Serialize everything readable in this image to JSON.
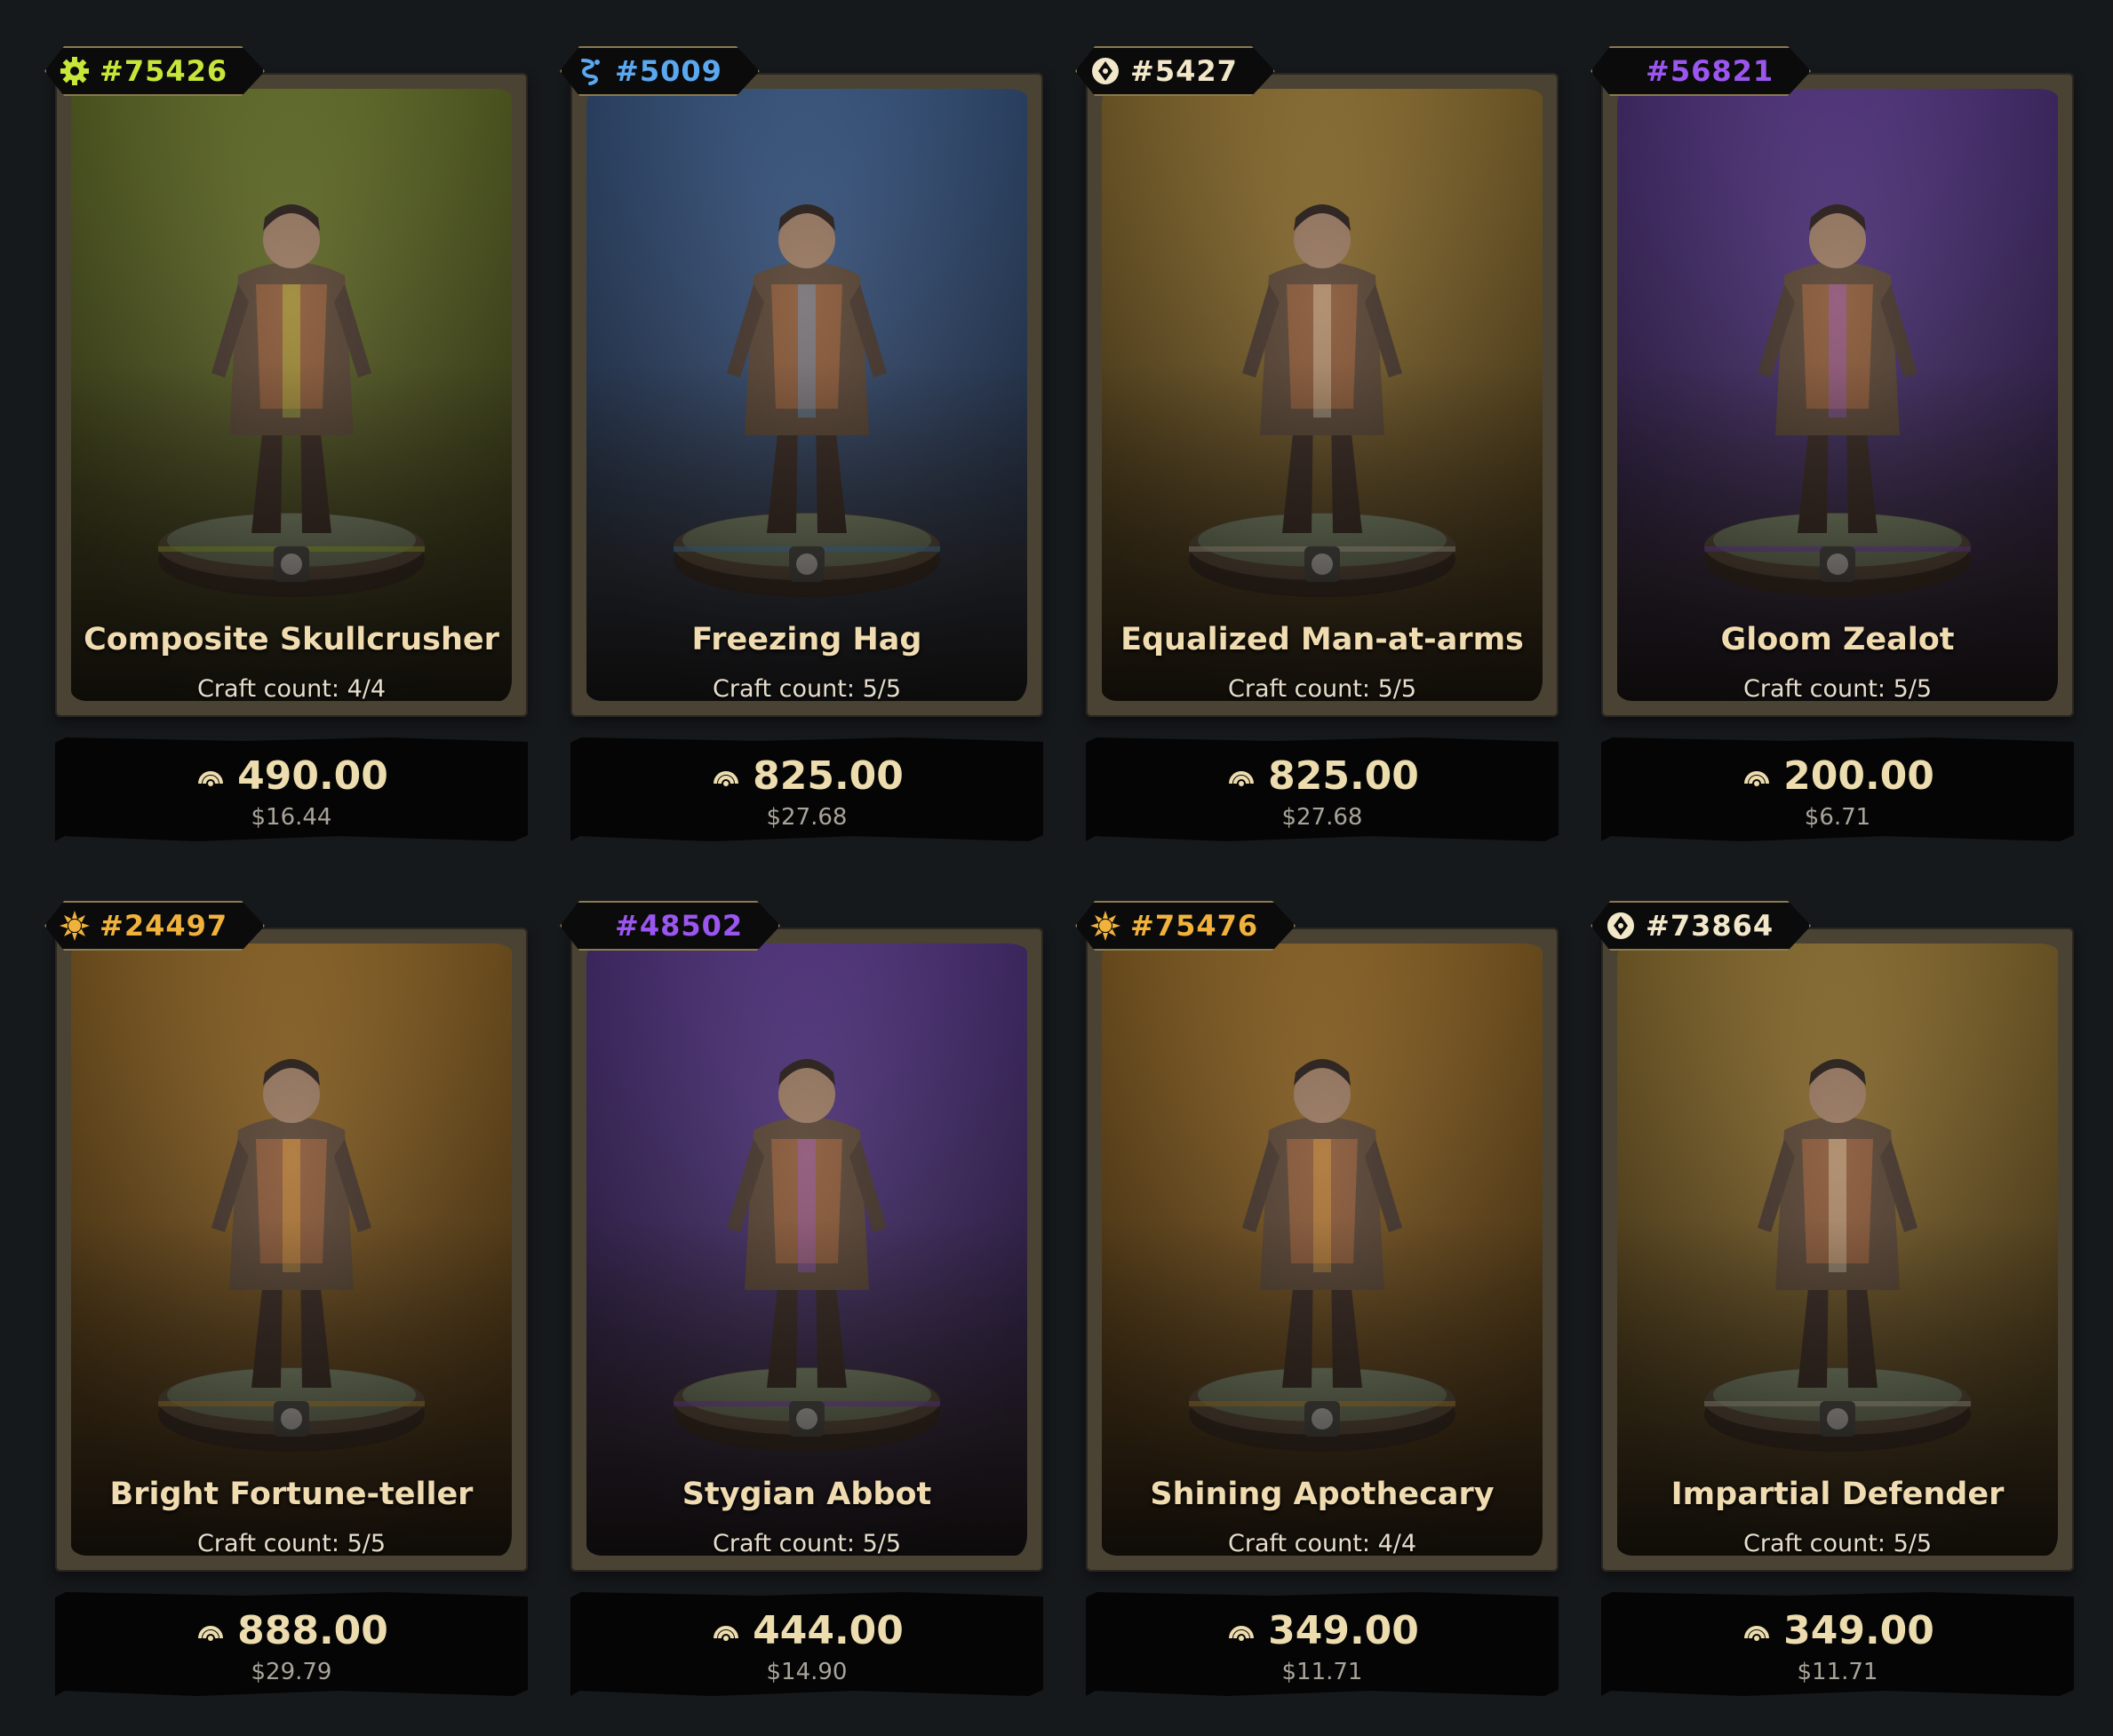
{
  "colors": {
    "page_bg": "#16191c",
    "frame": "#4a4334",
    "title": "#f0dcb0",
    "price": "#ecdcae",
    "usd": "#a9a49a"
  },
  "craft_label": "Craft count:",
  "cards": [
    {
      "id": "#75426",
      "element": "gear-icon",
      "accent": "#c7e63a",
      "bg_top": "#6e7a2e",
      "bg_bottom": "#3a3a1c",
      "name": "Composite Skullcrusher",
      "craft": "4/4",
      "price": "490.00",
      "usd": "$16.44"
    },
    {
      "id": "#5009",
      "element": "water-icon",
      "accent": "#5aa9f0",
      "bg_top": "#3e5f8e",
      "bg_bottom": "#2a3246",
      "name": "Freezing Hag",
      "craft": "5/5",
      "price": "825.00",
      "usd": "$27.68"
    },
    {
      "id": "#5427",
      "element": "balance-icon",
      "accent": "#f2e7c9",
      "bg_top": "#9a7a36",
      "bg_bottom": "#4a3a1c",
      "name": "Equalized Man-at-arms",
      "craft": "5/5",
      "price": "825.00",
      "usd": "$27.68"
    },
    {
      "id": "#56821",
      "element": "moon-icon",
      "accent": "#9b56f0",
      "bg_top": "#5a3a8c",
      "bg_bottom": "#2e2440",
      "name": "Gloom Zealot",
      "craft": "5/5",
      "price": "200.00",
      "usd": "$6.71"
    },
    {
      "id": "#24497",
      "element": "sun-icon",
      "accent": "#f0b23c",
      "bg_top": "#9a6e2a",
      "bg_bottom": "#4a3416",
      "name": "Bright Fortune-teller",
      "craft": "5/5",
      "price": "888.00",
      "usd": "$29.79"
    },
    {
      "id": "#48502",
      "element": "moon-icon",
      "accent": "#9b56f0",
      "bg_top": "#5a3a8c",
      "bg_bottom": "#2e2440",
      "name": "Stygian Abbot",
      "craft": "5/5",
      "price": "444.00",
      "usd": "$14.90"
    },
    {
      "id": "#75476",
      "element": "sun-icon",
      "accent": "#f0b23c",
      "bg_top": "#9a6e2a",
      "bg_bottom": "#4a3416",
      "name": "Shining Apothecary",
      "craft": "4/4",
      "price": "349.00",
      "usd": "$11.71"
    },
    {
      "id": "#73864",
      "element": "balance-icon",
      "accent": "#f2e7c9",
      "bg_top": "#9a7a36",
      "bg_bottom": "#4a3a1c",
      "name": "Impartial Defender",
      "craft": "5/5",
      "price": "349.00",
      "usd": "$11.71"
    }
  ]
}
